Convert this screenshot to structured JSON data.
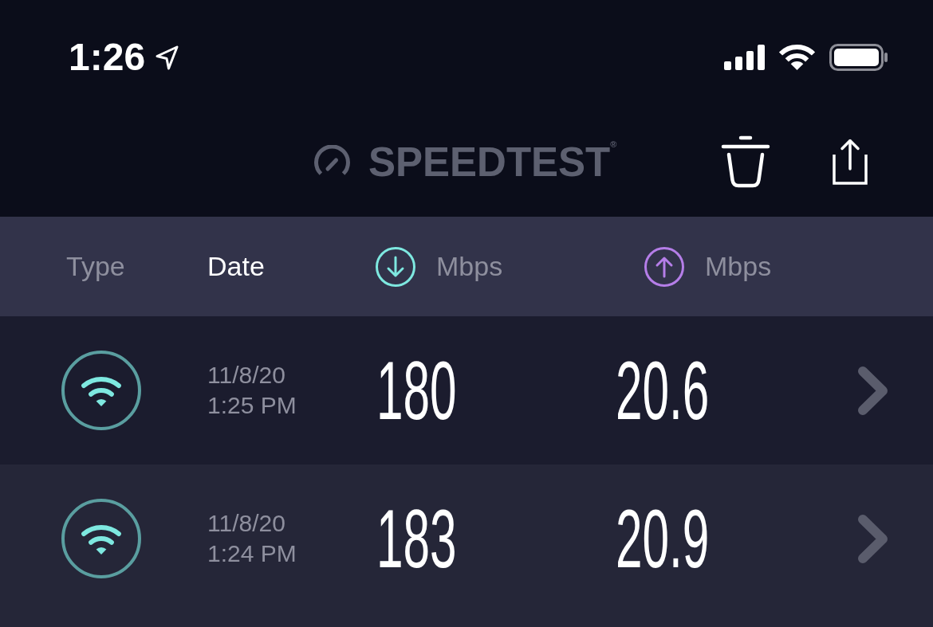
{
  "status_bar": {
    "time": "1:26"
  },
  "nav_bar": {
    "logo": "SPEEDTEST$^{®}$"
  },
  "table": {
    "columns": [
      {
        "kind": "text",
        "label": "Type",
        "selected": false
      },
      {
        "kind": "text",
        "label": "Date",
        "selected": true
      },
      {
        "kind": "download",
        "label": "Mbps",
        "selected": false,
        "color": "#7ee8e0"
      },
      {
        "kind": "upload",
        "label": "Mbps",
        "selected": false,
        "color": "#b57ee8"
      }
    ],
    "rows": [
      {
        "kind": "wifi",
        "date": "11/8/20",
        "time": "1:25 PM",
        "download": "180",
        "upload": "20.6"
      },
      {
        "kind": "wifi",
        "date": "11/8/20",
        "time": "1:24 PM",
        "download": "183",
        "upload": "20.9"
      }
    ]
  }
}
